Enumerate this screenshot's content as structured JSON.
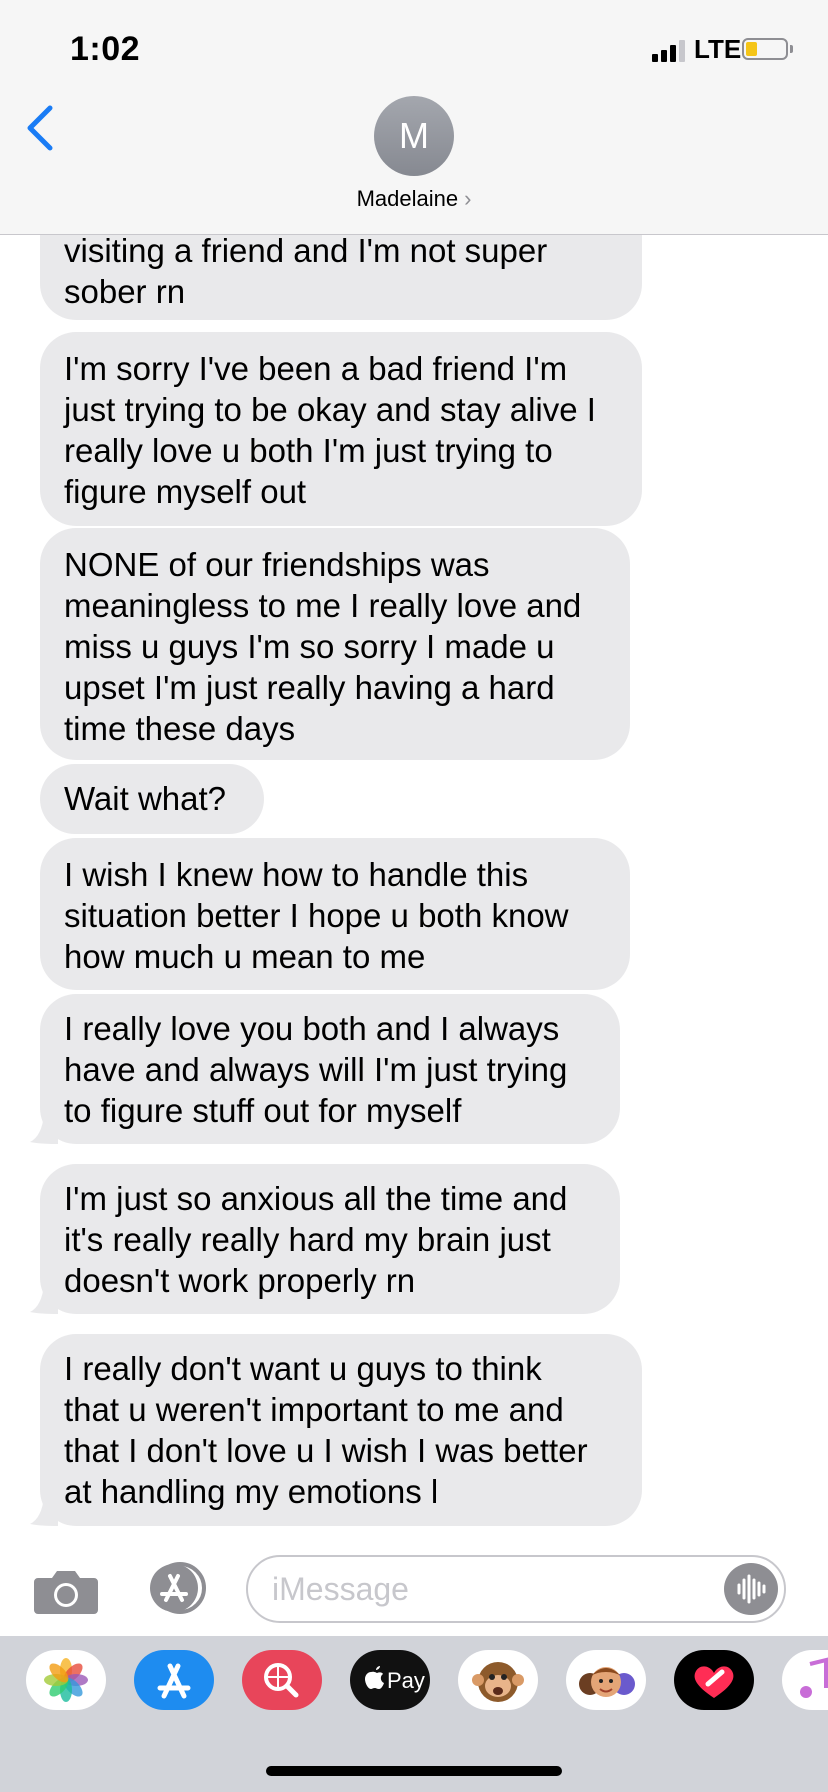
{
  "status_bar": {
    "time": "1:02",
    "network": "LTE"
  },
  "header": {
    "avatar_initial": "M",
    "contact_name": "Madelaine",
    "chevron": "›"
  },
  "messages": [
    {
      "text": "visiting a friend and I'm not super\nsober rn"
    },
    {
      "text": "I'm sorry I've been a bad friend I'm\njust trying to be okay and stay alive I\nreally love u both I'm just trying to\nfigure myself out"
    },
    {
      "text": "NONE of our friendships was\nmeaningless to me I really love and\nmiss u guys I'm so sorry I made u\nupset  I'm just really having a hard\ntime these days"
    },
    {
      "text": "Wait what?"
    },
    {
      "text": "I wish I knew how to handle this\nsituation better I hope u both know\nhow much u mean to me"
    },
    {
      "text": "I really love you both and I always\nhave and always will I'm just trying\nto figure stuff out for myself"
    },
    {
      "text": "I'm just so anxious all the time and\nit's really really hard my brain just\ndoesn't work properly rn"
    },
    {
      "text": "I really don't want u guys to think\nthat u weren't important to me and\nthat I don't love u I wish I was better\nat handling my emotions l"
    }
  ],
  "input": {
    "placeholder": "iMessage"
  },
  "app_drawer": {
    "apps": [
      {
        "name": "photos-icon"
      },
      {
        "name": "app-store-icon"
      },
      {
        "name": "web-images-icon"
      },
      {
        "name": "apple-pay-icon",
        "label": "Pay"
      },
      {
        "name": "animoji-icon"
      },
      {
        "name": "memoji-icon"
      },
      {
        "name": "digital-touch-icon"
      },
      {
        "name": "music-icon"
      }
    ]
  },
  "colors": {
    "accent": "#1a7cf5",
    "bubble": "#e9e9eb",
    "drawer": "#d1d3d9"
  }
}
